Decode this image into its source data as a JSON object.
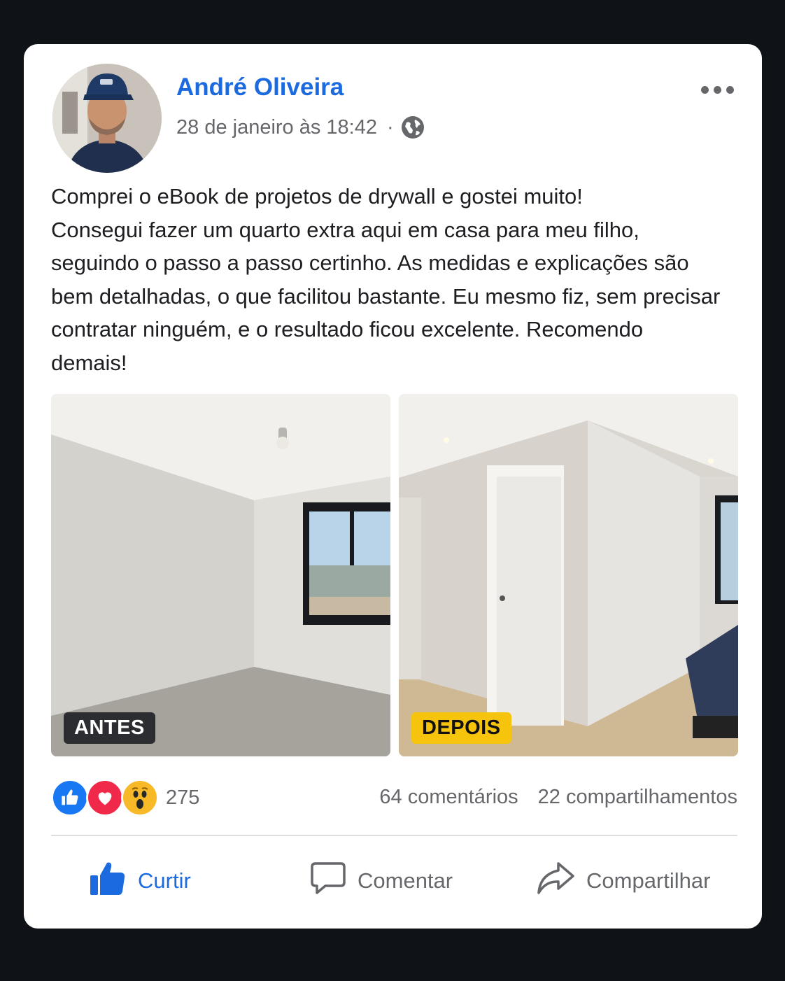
{
  "post": {
    "author": "André Oliveira",
    "timestamp": "28 de janeiro às 18:42",
    "separator": "·",
    "privacy_icon": "globe-icon",
    "menu_icon": "more-options-icon",
    "text": "Comprei o eBook de projetos de drywall e gostei muito!\nConsegui fazer um quarto extra aqui em casa para meu filho,\nseguindo o passo a passo certinho. As medidas e explicações são\nbem detalhadas, o que facilitou bastante. Eu mesmo fiz, sem precisar\ncontratar ninguém, e o resultado ficou excelente. Recomendo\ndemais!"
  },
  "photos": [
    {
      "label": "ANTES",
      "label_color": "#2b2d30",
      "label_text_color": "#ffffff"
    },
    {
      "label": "DEPOIS",
      "label_color": "#f6c40c",
      "label_text_color": "#111111"
    }
  ],
  "reactions": {
    "icons": [
      "like-reaction-icon",
      "love-reaction-icon",
      "wow-reaction-icon"
    ],
    "count": "275"
  },
  "stats": {
    "comments": "64 comentários",
    "shares": "22 compartilhamentos"
  },
  "actions": {
    "like": "Curtir",
    "comment": "Comentar",
    "share": "Compartilhar"
  },
  "colors": {
    "brand_blue": "#1b6ae0",
    "like_blue": "#1877f2",
    "love_red": "#f02849",
    "wow_yellow": "#f7b928",
    "background": "#0f1216",
    "card": "#ffffff"
  }
}
